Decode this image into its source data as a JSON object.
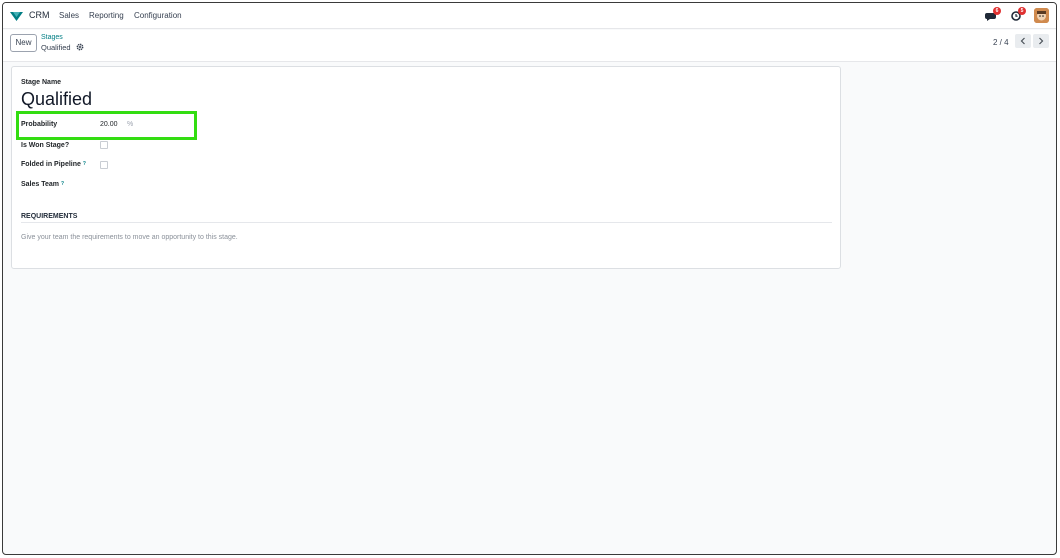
{
  "navbar": {
    "app_name": "CRM",
    "menu": [
      "Sales",
      "Reporting",
      "Configuration"
    ],
    "messages_badge": "6",
    "activities_badge": "5"
  },
  "control": {
    "new_label": "New",
    "breadcrumb_parent": "Stages",
    "breadcrumb_current": "Qualified",
    "pager": "2 / 4"
  },
  "form": {
    "stage_name_label": "Stage Name",
    "stage_name": "Qualified",
    "probability_label": "Probability",
    "probability_value": "20.00",
    "probability_unit": "%",
    "is_won_label": "Is Won Stage?",
    "is_won_checked": false,
    "folded_label": "Folded in Pipeline",
    "folded_checked": false,
    "sales_team_label": "Sales Team",
    "help_mark": "?",
    "requirements_title": "REQUIREMENTS",
    "requirements_placeholder": "Give your team the requirements to move an opportunity to this stage."
  },
  "colors": {
    "brand": "#017e84",
    "highlight": "#33dd11",
    "badge": "#e03131"
  },
  "icons": [
    "crm-logo-icon",
    "messages-icon",
    "activities-icon",
    "gear-icon",
    "chevron-left-icon",
    "chevron-right-icon"
  ]
}
